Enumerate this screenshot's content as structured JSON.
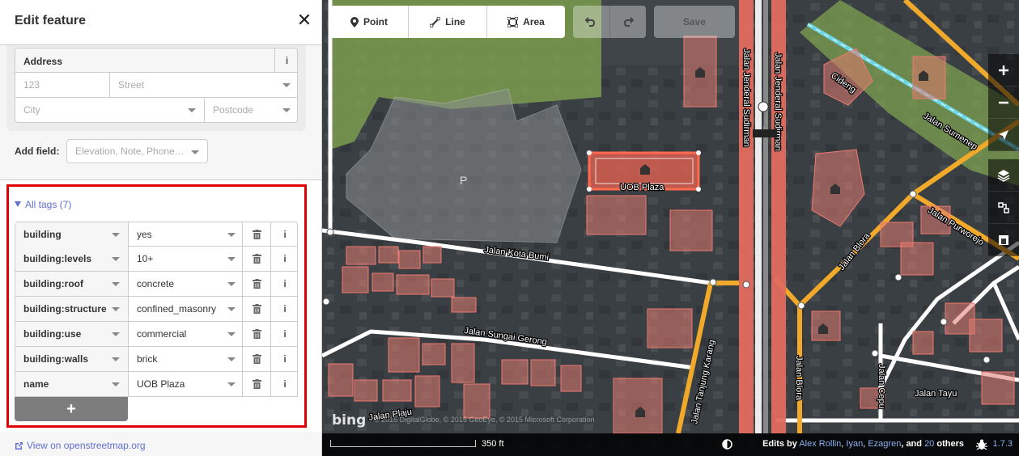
{
  "sidebar": {
    "title": "Edit feature",
    "close_glyph": "✕",
    "address": {
      "label": "Address",
      "info_glyph": "i",
      "housenumber_placeholder": "123",
      "street_placeholder": "Street",
      "city_placeholder": "City",
      "postcode_placeholder": "Postcode"
    },
    "add_field": {
      "label": "Add field:",
      "placeholder": "Elevation, Note, Phone…"
    },
    "all_tags": {
      "label": "All tags (7)",
      "add_glyph": "+",
      "tags": [
        {
          "key": "building",
          "value": "yes"
        },
        {
          "key": "building:levels",
          "value": "10+"
        },
        {
          "key": "building:roof",
          "value": "concrete"
        },
        {
          "key": "building:structure",
          "value": "confined_masonry"
        },
        {
          "key": "building:use",
          "value": "commercial"
        },
        {
          "key": "building:walls",
          "value": "brick"
        },
        {
          "key": "name",
          "value": "UOB Plaza"
        }
      ],
      "highlight_color": "#e00000"
    },
    "osm_link": "View on openstreetmap.org"
  },
  "toolbar": {
    "point_label": "Point",
    "line_label": "Line",
    "area_label": "Area",
    "save_label": "Save"
  },
  "map": {
    "street_labels": {
      "sudirman_1": "Jalan Jenderal Sudirman",
      "sudirman_2": "Jalan Jenderal Sudirman",
      "kota_bumi": "Jalan Kota Bumi",
      "sungai_gerong": "Jalan Sungai Gerong",
      "tanjung_karang": "Jalan Tanjung Karang",
      "blora_1": "Jalan Blora",
      "blora_2": "Jalan Blora",
      "plaju": "Jalan Plaju",
      "cepu": "Jalan Cepu",
      "tayu": "Jalan Tayu",
      "cideng": "Cideng",
      "sumenep": "Jalan Sumenep",
      "purworejo": "Jalan Purworejo",
      "parking": "P"
    },
    "selected_building": "UOB Plaza",
    "colors": {
      "selected": "#e06050",
      "building": "#e07a70",
      "park": "#8cc062",
      "primary": "#e06c5e",
      "secondary": "#f0a92a",
      "railway": "#6cd6e6"
    }
  },
  "footer": {
    "scale": "350 ft",
    "bing_logo": "bing",
    "imagery_credit": "© 2015 DigitalGlobe, © 2015 GeoEye, © 2015 Microsoft Corporation",
    "edits_by": "Edits by",
    "contributors": [
      "Alex Rollin",
      "Iyan",
      "Ezagren"
    ],
    "and": ", and",
    "others_count": "20",
    "others_label": "others",
    "version": "1.7.3"
  }
}
